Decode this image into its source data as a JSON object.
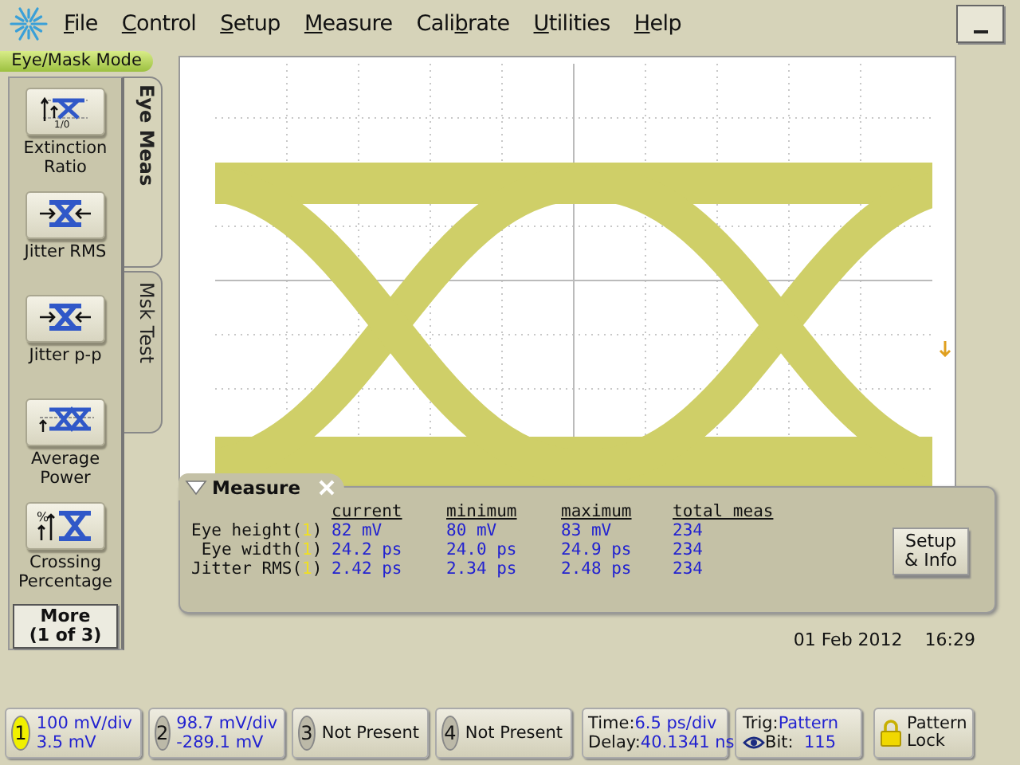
{
  "menu": {
    "items": [
      {
        "accel": "F",
        "after": "ile"
      },
      {
        "accel": "C",
        "after": "ontrol"
      },
      {
        "accel": "S",
        "after": "etup"
      },
      {
        "accel": "M",
        "after": "easure"
      },
      {
        "before": "Cali",
        "accel": "b",
        "after": "rate"
      },
      {
        "accel": "U",
        "after": "tilities"
      },
      {
        "accel": "H",
        "after": "elp"
      }
    ]
  },
  "mode": "Eye/Mask Mode",
  "meas_buttons": [
    {
      "kind": "extinction",
      "label": "Extinction Ratio",
      "icon_text": "1/0"
    },
    {
      "kind": "jitter",
      "label": "Jitter RMS"
    },
    {
      "kind": "jitter",
      "label": "Jitter p-p"
    },
    {
      "kind": "power",
      "label": "Average Power"
    },
    {
      "kind": "crossing",
      "label": "Crossing Percentage",
      "icon_text": "%"
    }
  ],
  "more_button": {
    "line1": "More",
    "line2": "(1 of 3)"
  },
  "tabs": [
    {
      "label": "Eye Meas",
      "selected": true
    },
    {
      "label": "Msk Test",
      "selected": false
    }
  ],
  "measure": {
    "title": "Measure",
    "columns": [
      "current",
      "minimum",
      "maximum",
      "total meas"
    ],
    "rows": [
      {
        "label": "Eye height(",
        "source": "1",
        "label_end": ")",
        "values": [
          "82 mV",
          "80 mV",
          "83 mV",
          "234"
        ]
      },
      {
        "label": " Eye width(",
        "source": "1",
        "label_end": ")",
        "values": [
          "24.2 ps",
          "24.0 ps",
          "24.9 ps",
          "234"
        ]
      },
      {
        "label": "Jitter RMS(",
        "source": "1",
        "label_end": ")",
        "values": [
          "2.42 ps",
          "2.34 ps",
          "2.48 ps",
          "234"
        ]
      }
    ],
    "setup_button": {
      "line1": "Setup",
      "line2": "& Info"
    }
  },
  "date": "01 Feb 2012",
  "time": "16:29",
  "channels": [
    {
      "kind": "channel",
      "number": "1",
      "active": true,
      "line1": "100 mV/div",
      "line2": "3.5 mV"
    },
    {
      "kind": "channel",
      "number": "2",
      "active": false,
      "line1": "98.7 mV/div",
      "line2": "-289.1 mV"
    },
    {
      "kind": "absent",
      "number": "3",
      "active": false,
      "text": "Not Present"
    },
    {
      "kind": "absent",
      "number": "4",
      "active": false,
      "text": "Not Present"
    }
  ],
  "timebase": {
    "time_label": "Time:",
    "time": "6.5 ps/div",
    "delay_label": "Delay:",
    "delay": "40.1341 ns"
  },
  "trigger": {
    "label": "Trig:",
    "source": "Pattern",
    "bit_label": "Bit:",
    "bit": "115"
  },
  "lock_button": {
    "line1": "Pattern",
    "line2": "Lock"
  }
}
